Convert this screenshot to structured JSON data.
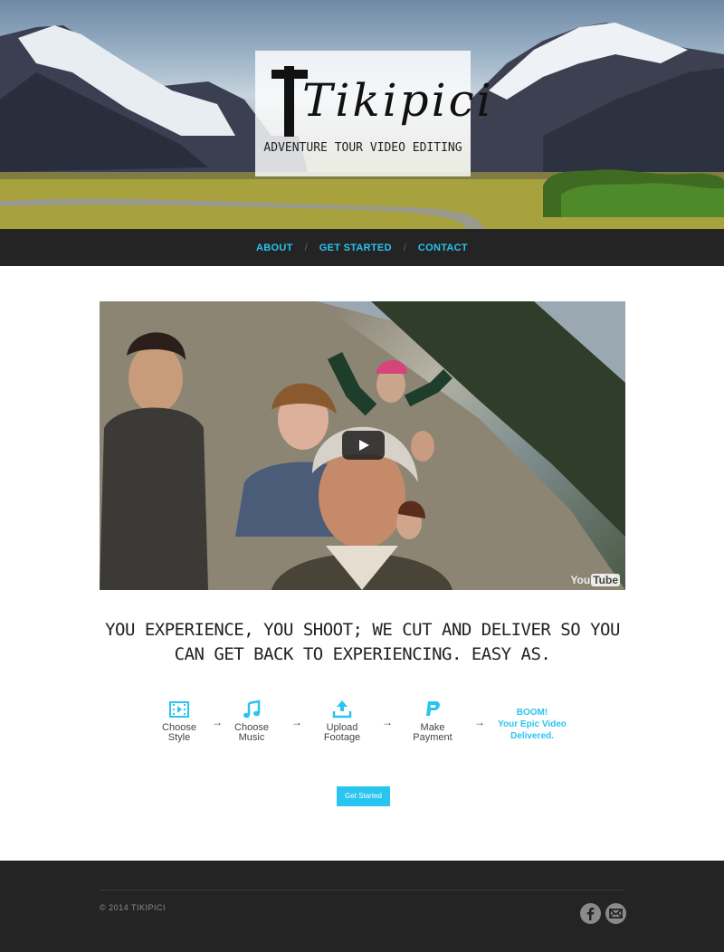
{
  "brand": {
    "title": "Tikipici",
    "subtitle": "ADVENTURE TOUR VIDEO EDITING"
  },
  "nav": {
    "items": [
      {
        "label": "ABOUT"
      },
      {
        "label": "GET STARTED"
      },
      {
        "label": "CONTACT"
      }
    ],
    "separator": "/"
  },
  "video": {
    "provider": "YouTube",
    "provider_you": "You",
    "provider_tube": "Tube"
  },
  "tagline": "YOU EXPERIENCE, YOU SHOOT; WE CUT AND DELIVER SO YOU CAN GET BACK TO EXPERIENCING. EASY AS.",
  "steps": [
    {
      "icon": "film-icon",
      "line1": "Choose",
      "line2": "Style"
    },
    {
      "icon": "music-note-icon",
      "line1": "Choose",
      "line2": "Music"
    },
    {
      "icon": "upload-icon",
      "line1": "Upload",
      "line2": "Footage"
    },
    {
      "icon": "paypal-icon",
      "line1": "Make",
      "line2": "Payment"
    }
  ],
  "step_arrow": "→",
  "final_step": {
    "line1": "BOOM!",
    "line2": "Your Epic Video",
    "line3": "Delivered."
  },
  "cta_label": "Get Started",
  "footer": {
    "copyright": "© 2014 TIKIPICI",
    "social": [
      "facebook-icon",
      "email-icon"
    ]
  },
  "colors": {
    "accent": "#29c4f0",
    "dark": "#242424",
    "footer_text": "#8a8a8a"
  }
}
